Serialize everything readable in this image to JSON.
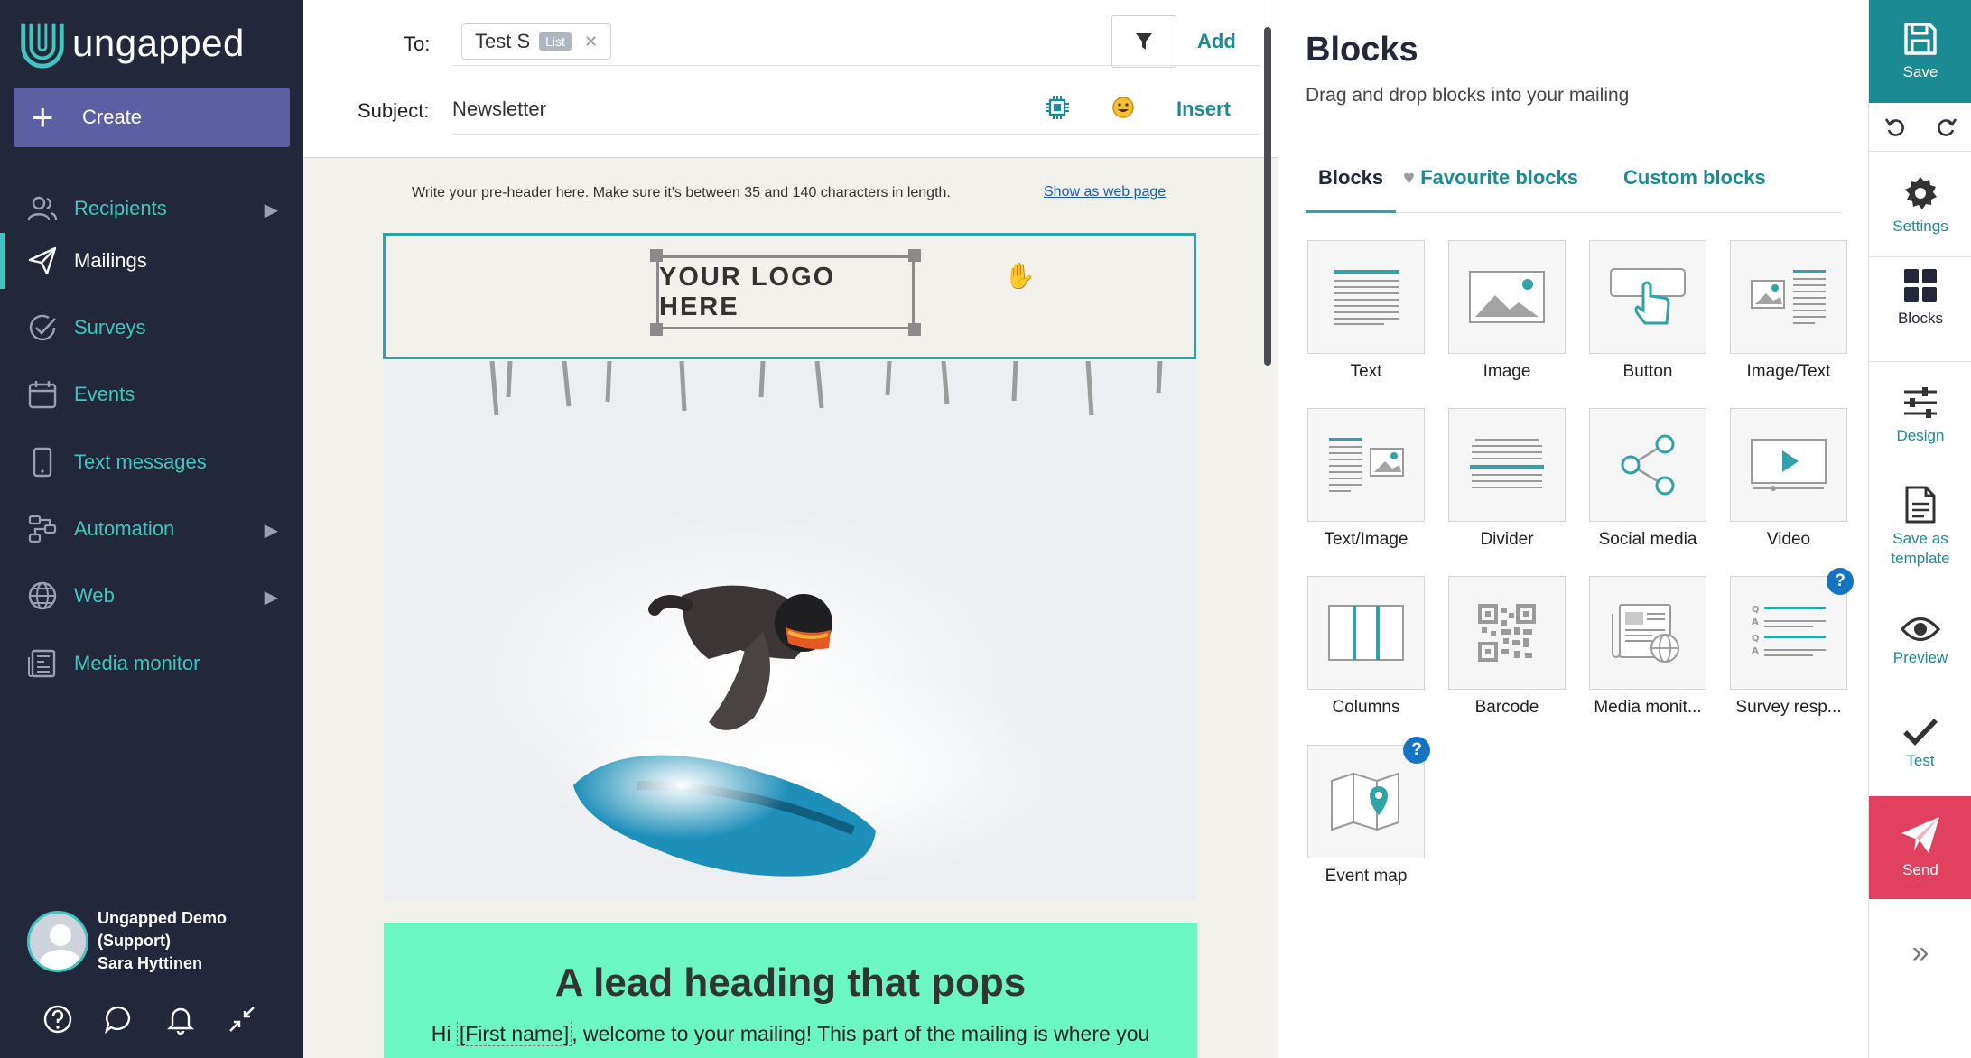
{
  "brand": {
    "name": "ungapped",
    "accent": "#3fc6c0",
    "teal": "#1c8a93",
    "sidebar_bg": "#22273a",
    "send_red": "#e2405f"
  },
  "sidebar": {
    "create_label": "Create",
    "items": [
      {
        "label": "Recipients",
        "icon": "users-icon",
        "has_submenu": true
      },
      {
        "label": "Mailings",
        "icon": "paper-plane-icon",
        "active": true
      },
      {
        "label": "Surveys",
        "icon": "check-circle-icon"
      },
      {
        "label": "Events",
        "icon": "calendar-icon"
      },
      {
        "label": "Text messages",
        "icon": "mobile-icon"
      },
      {
        "label": "Automation",
        "icon": "workflow-icon",
        "has_submenu": true
      },
      {
        "label": "Web",
        "icon": "globe-icon",
        "has_submenu": true
      },
      {
        "label": "Media monitor",
        "icon": "newspaper-icon"
      }
    ],
    "user": {
      "line1": "Ungapped Demo",
      "line2": "(Support)",
      "line3": "Sara Hyttinen"
    },
    "bottom_icons": [
      "help-icon",
      "chat-icon",
      "bell-icon",
      "collapse-icon"
    ]
  },
  "header": {
    "to_label": "To:",
    "recipient_chip": "Test S",
    "recipient_tag": "List",
    "add_label": "Add",
    "subject_label": "Subject:",
    "subject_value": "Newsletter",
    "insert_label": "Insert"
  },
  "mailing": {
    "preheader": "Write your pre-header here. Make sure it's between 35 and 140 characters in length.",
    "webpage_link": "Show as web page",
    "logo_text": "YOUR LOGO HERE",
    "lead_heading": "A lead heading that pops",
    "lead_body_prefix": "Hi",
    "lead_body_merge": "[First name]",
    "lead_body_rest": ", welcome to your mailing! This part of the mailing is where you"
  },
  "blocks_panel": {
    "title": "Blocks",
    "subtitle": "Drag and drop blocks into your mailing",
    "tabs": [
      "Blocks",
      "Favourite blocks",
      "Custom blocks"
    ],
    "tiles": [
      {
        "name": "Text",
        "icon": "text-block-icon"
      },
      {
        "name": "Image",
        "icon": "image-block-icon"
      },
      {
        "name": "Button",
        "icon": "button-block-icon"
      },
      {
        "name": "Image/Text",
        "icon": "image-text-block-icon"
      },
      {
        "name": "Text/Image",
        "icon": "text-image-block-icon"
      },
      {
        "name": "Divider",
        "icon": "divider-block-icon"
      },
      {
        "name": "Social media",
        "icon": "share-block-icon"
      },
      {
        "name": "Video",
        "icon": "video-block-icon"
      },
      {
        "name": "Columns",
        "icon": "columns-block-icon"
      },
      {
        "name": "Barcode",
        "icon": "qr-code-block-icon"
      },
      {
        "name": "Media monit...",
        "icon": "media-monitor-block-icon"
      },
      {
        "name": "Survey resp...",
        "icon": "survey-block-icon",
        "help": "?"
      },
      {
        "name": "Event map",
        "icon": "map-block-icon",
        "help": "?"
      }
    ]
  },
  "actions": {
    "save": "Save",
    "settings": "Settings",
    "blocks": "Blocks",
    "design": "Design",
    "save_template_1": "Save as",
    "save_template_2": "template",
    "preview": "Preview",
    "test": "Test",
    "send": "Send"
  }
}
